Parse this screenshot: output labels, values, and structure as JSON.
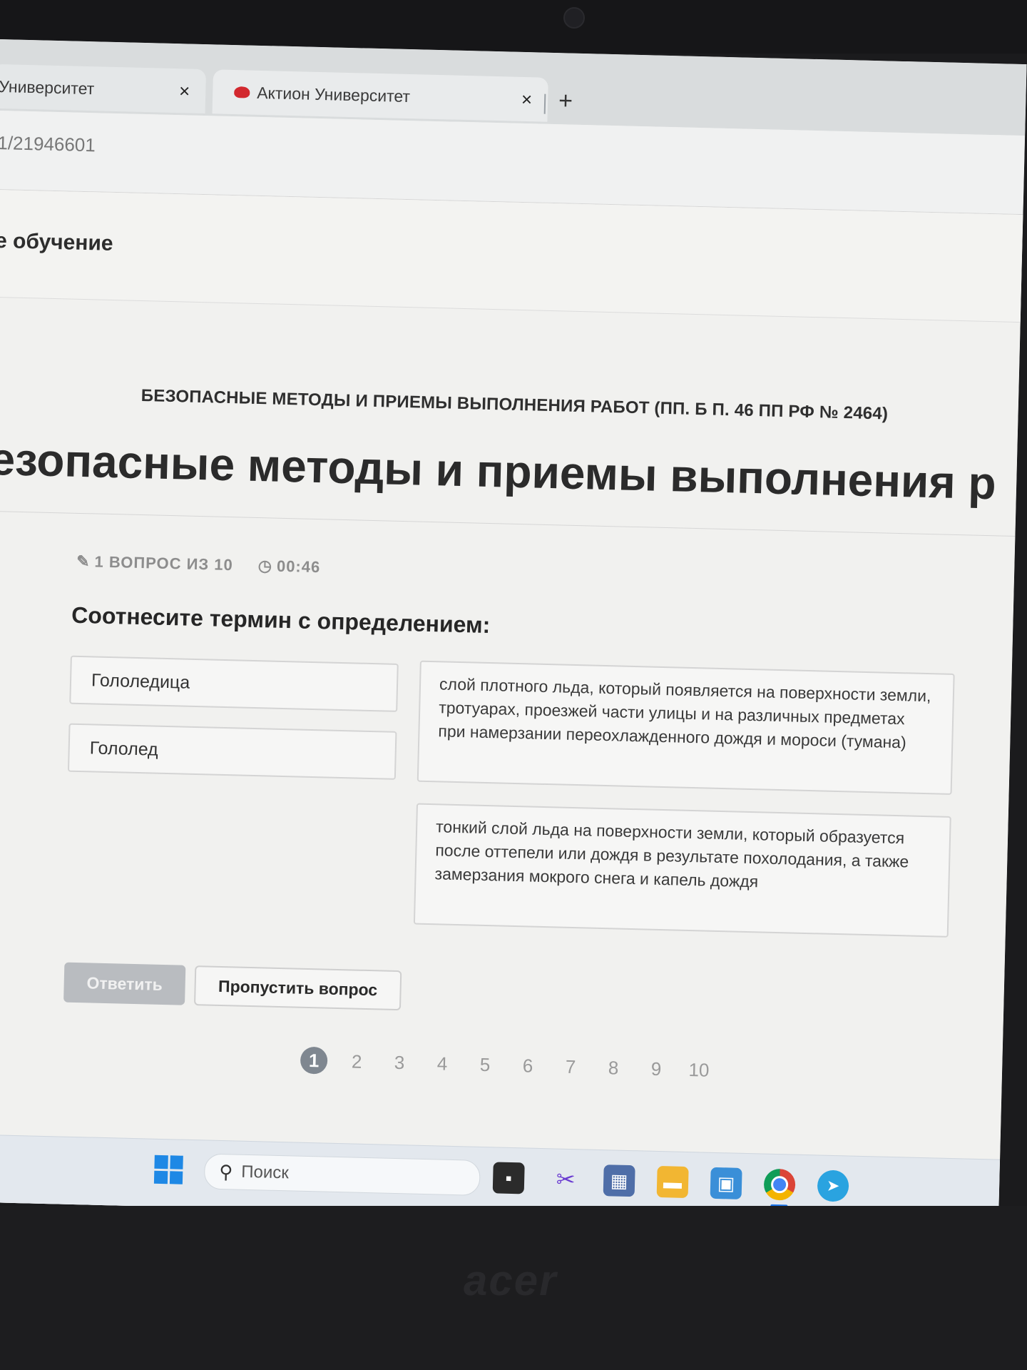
{
  "browser": {
    "tabs": [
      {
        "label": "Университет",
        "close": "×"
      },
      {
        "label": "Актион Университет",
        "close": "×"
      }
    ],
    "new_tab": "+",
    "url": "1/21946601"
  },
  "site_nav": {
    "item": "е обучение"
  },
  "course": {
    "caption": "БЕЗОПАСНЫЕ МЕТОДЫ И ПРИЕМЫ ВЫПОЛНЕНИЯ РАБОТ (ПП. Б П. 46 ПП РФ № 2464)",
    "title": "езопасные методы и приемы выполнения р"
  },
  "quiz": {
    "progress": "1 ВОПРОС ИЗ 10",
    "timer": "00:46",
    "question": "Соотнесите термин с определением:",
    "terms": [
      "Гололедица",
      "Гололед"
    ],
    "definitions": [
      "слой плотного льда, который появляется на поверхности земли, тротуарах, проезжей части улицы и на различных предметах при намерзании переохлажденного дождя и мороси (тумана)",
      "тонкий слой льда на поверхности земли, который образуется после оттепели или дождя в результате похолодания, а также замерзания мокрого снега и капель дождя"
    ],
    "answer_button": "Ответить",
    "skip_button": "Пропустить вопрос",
    "pages": [
      "1",
      "2",
      "3",
      "4",
      "5",
      "6",
      "7",
      "8",
      "9",
      "10"
    ],
    "current_page": "1"
  },
  "taskbar": {
    "search_placeholder": "Поиск",
    "icons": [
      "task-view-icon",
      "snipping-tool-icon",
      "calculator-icon",
      "file-explorer-icon",
      "control-panel-icon",
      "chrome-icon",
      "telegram-icon"
    ]
  },
  "device": {
    "brand": "acer"
  }
}
